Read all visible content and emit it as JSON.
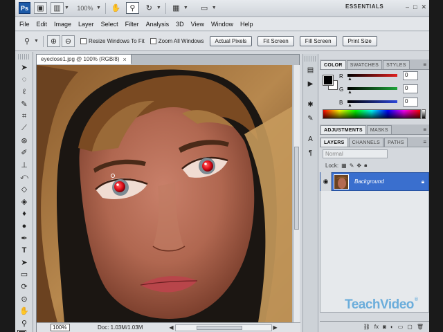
{
  "app": {
    "logo": "Ps",
    "zoom": "100%",
    "workspace": "ESSENTIALS",
    "window_controls": [
      "–",
      "□",
      "✕"
    ]
  },
  "menu": [
    "File",
    "Edit",
    "Image",
    "Layer",
    "Select",
    "Filter",
    "Analysis",
    "3D",
    "View",
    "Window",
    "Help"
  ],
  "options": {
    "resize_windows_label": "Resize Windows To Fit",
    "zoom_all_windows_label": "Zoom All Windows",
    "buttons": [
      "Actual Pixels",
      "Fit Screen",
      "Fill Screen",
      "Print Size"
    ]
  },
  "document": {
    "tab_title": "eyeclose1.jpg @ 100% (RGB/8)",
    "close_symbol": "×",
    "zoom_field": "100%",
    "doc_info": "Doc: 1.03M/1.03M"
  },
  "panels": {
    "color": {
      "tabs": [
        "COLOR",
        "SWATCHES",
        "STYLES"
      ],
      "channels": [
        {
          "label": "R",
          "value": "0",
          "color": "#e0201e"
        },
        {
          "label": "G",
          "value": "0",
          "color": "#1ea43a"
        },
        {
          "label": "B",
          "value": "0",
          "color": "#2c46d8"
        }
      ]
    },
    "adjustments": {
      "tabs": [
        "ADJUSTMENTS",
        "MASKS"
      ]
    },
    "layers": {
      "tabs": [
        "LAYERS",
        "CHANNELS",
        "PATHS"
      ],
      "blend_mode": "Normal",
      "lock_label": "Lock:",
      "layer_name": "Background"
    }
  },
  "watermark": "TeachVideo"
}
